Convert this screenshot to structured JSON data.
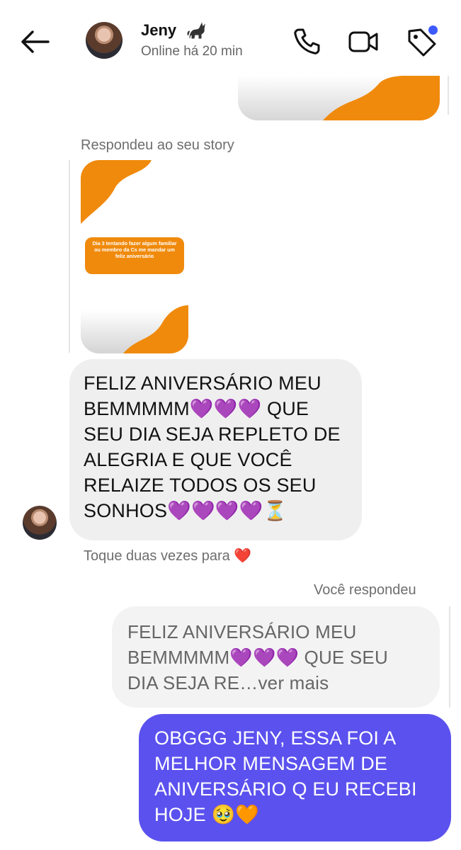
{
  "header": {
    "contact_name": "Jeny",
    "presence": "Online há 20 min",
    "icons": [
      "back-arrow-icon",
      "cat-icon",
      "phone-icon",
      "video-camera-icon",
      "tag-icon"
    ]
  },
  "thread": {
    "story_reply_label": "Respondeu ao seu story",
    "story_text": "Dia 3 tentando fazer algum familiar ou membro da Cs me mandar um feliz aniversário",
    "incoming_message": "FELIZ ANIVERSÁRIO MEU BEMMMMM💜💜💜 QUE SEU DIA SEJA REPLETO DE ALEGRIA E QUE VOCÊ RELAIZE TODOS OS SEU SONHOS💜💜💜💜⏳",
    "like_hint": "Toque duas vezes para ❤️",
    "you_replied_label": "Você respondeu",
    "quoted_message": "FELIZ ANIVERSÁRIO MEU BEMMMMM💜💜💜 QUE SEU DIA SEJA RE…ver mais",
    "outgoing_message": "OBGGG JENY, ESSA FOI A MELHOR MENSAGEM DE ANIVERSÁRIO Q EU RECEBI HOJE 🥹🧡"
  },
  "colors": {
    "outgoing_bubble": "#5b51ee",
    "incoming_bubble": "#efefef",
    "story_orange": "#f08a0c",
    "notification_dot": "#3d5afe"
  }
}
